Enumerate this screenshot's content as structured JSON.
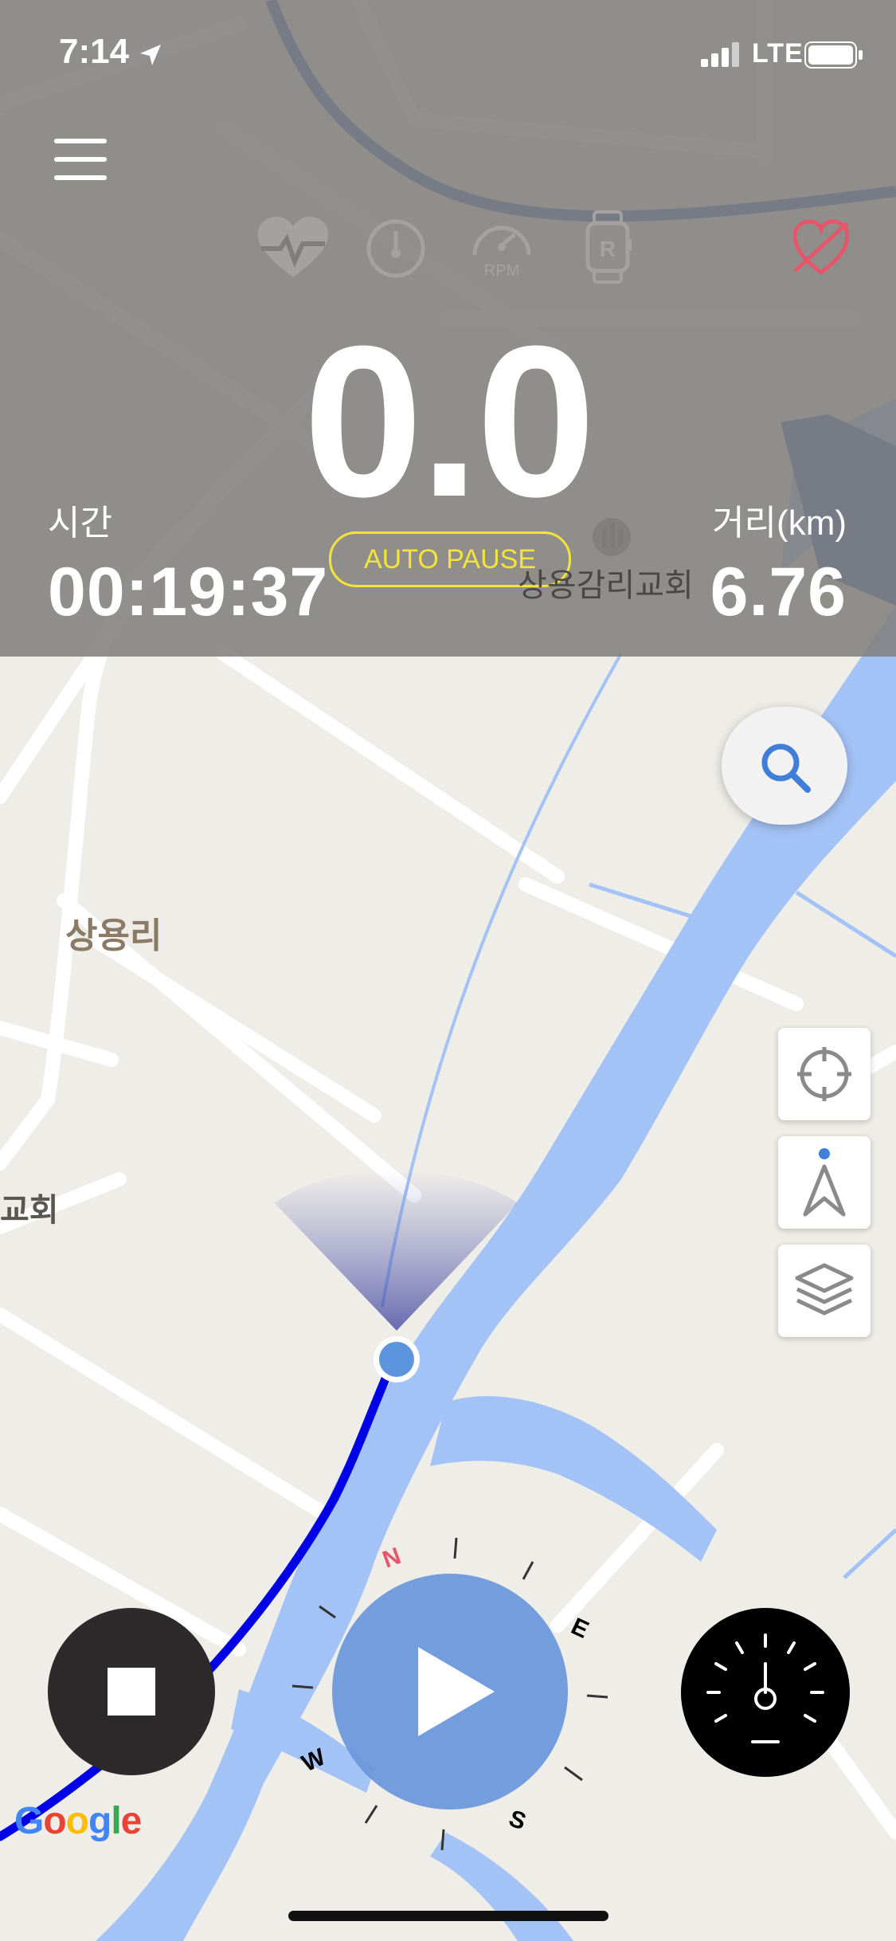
{
  "status_bar": {
    "time": "7:14",
    "network": "LTE"
  },
  "metrics": {
    "speed": "0.0",
    "time_label": "시간",
    "time_value": "00:19:37",
    "distance_label": "거리(km)",
    "distance_value": "6.76",
    "auto_pause": "AUTO PAUSE"
  },
  "sensors": {
    "rpm_label": "RPM"
  },
  "map_labels": {
    "church_right": "상용감리교회",
    "village": "상용리",
    "church_left": "교회"
  },
  "compass": {
    "n": "N",
    "e": "E",
    "s": "S",
    "w": "W"
  },
  "google": {
    "g1": "G",
    "o1": "o",
    "o2": "o",
    "g2": "g",
    "l": "l",
    "e": "e"
  },
  "colors": {
    "route": "#0000e6",
    "river": "#a3c2f5",
    "accent_yellow": "#f3e33b",
    "play": "#6896da",
    "heart_off": "#e6556a"
  }
}
